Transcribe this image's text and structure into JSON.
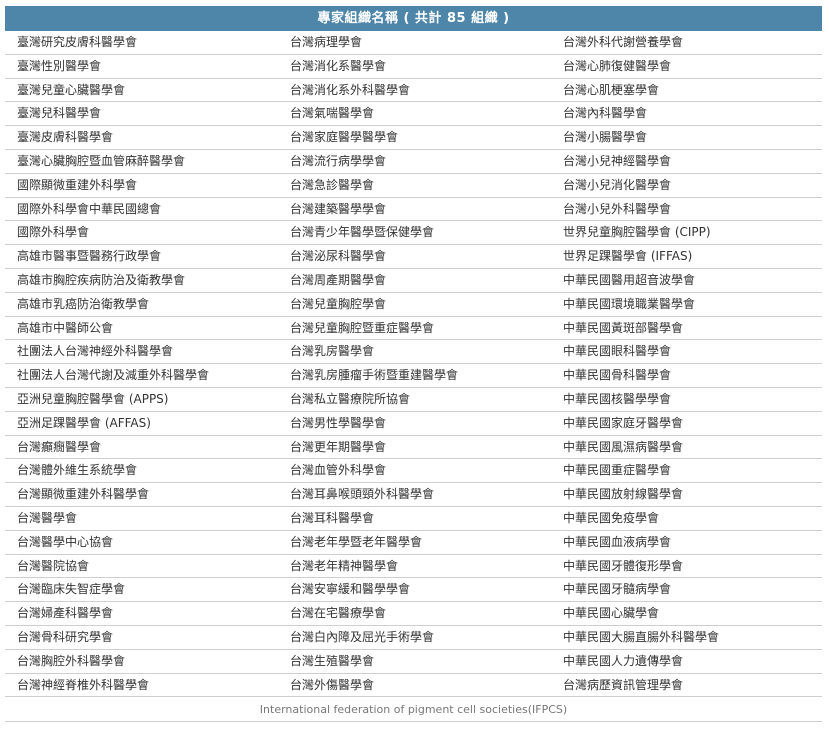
{
  "table": {
    "title": "專家組織名稱 ( 共計 85 組織 )",
    "columns": [
      [
        "臺灣研究皮膚科醫學會",
        "臺灣性別醫學會",
        "臺灣兒童心臟醫學會",
        "臺灣兒科醫學會",
        "臺灣皮膚科醫學會",
        "臺灣心臟胸腔暨血管麻醉醫學會",
        "國際顯微重建外科學會",
        "國際外科學會中華民國總會",
        "國際外科學會",
        "高雄市醫事暨醫務行政學會",
        "高雄市胸腔疾病防治及衛教學會",
        "高雄市乳癌防治衛教學會",
        "高雄市中醫師公會",
        "社團法人台灣神經外科醫學會",
        "社團法人台灣代謝及減重外科醫學會",
        "亞洲兒童胸腔醫學會 (APPS)",
        "亞洲足踝醫學會 (AFFAS)",
        "台灣癲癇醫學會",
        "台灣體外維生系統學會",
        "台灣顯微重建外科醫學會",
        "台灣醫學會",
        "台灣醫學中心協會",
        "台灣醫院協會",
        "台灣臨床失智症學會",
        "台灣婦產科醫學會",
        "台灣骨科研究學會",
        "台灣胸腔外科醫學會",
        "台灣神經脊椎外科醫學會"
      ],
      [
        "台灣病理學會",
        "台灣消化系醫學會",
        "台灣消化系外科醫學會",
        "台灣氣喘醫學會",
        "台灣家庭醫學醫學會",
        "台灣流行病學學會",
        "台灣急診醫學會",
        "台灣建築醫學學會",
        "台灣青少年醫學暨保健學會",
        "台灣泌尿科醫學會",
        "台灣周產期醫學會",
        "台灣兒童胸腔學會",
        "台灣兒童胸腔暨重症醫學會",
        "台灣乳房醫學會",
        "台灣乳房腫瘤手術暨重建醫學會",
        "台灣私立醫療院所協會",
        "台灣男性學醫學會",
        "台灣更年期醫學會",
        "台灣血管外科學會",
        "台灣耳鼻喉頭頸外科醫學會",
        "台灣耳科醫學會",
        "台灣老年學暨老年醫學會",
        "台灣老年精神醫學會",
        "台灣安寧緩和醫學學會",
        "台灣在宅醫療學會",
        "台灣白內障及屈光手術學會",
        "台灣生殖醫學會",
        "台灣外傷醫學會"
      ],
      [
        "台灣外科代謝營養學會",
        "台灣心肺復健醫學會",
        "台灣心肌梗塞學會",
        "台灣內科醫學會",
        "台灣小腸醫學會",
        "台灣小兒神經醫學會",
        "台灣小兒消化醫學會",
        "台灣小兒外科醫學會",
        "世界兒童胸腔醫學會 (CIPP)",
        "世界足踝醫學會 (IFFAS)",
        "中華民國醫用超音波學會",
        "中華民國環境職業醫學會",
        "中華民國黃斑部醫學會",
        "中華民國眼科醫學會",
        "中華民國骨科醫學會",
        "中華民國核醫學學會",
        "中華民國家庭牙醫學會",
        "中華民國風濕病醫學會",
        "中華民國重症醫學會",
        "中華民國放射線醫學會",
        "中華民國免疫學會",
        "中華民國血液病學會",
        "中華民國牙體復形學會",
        "中華民國牙髓病學會",
        "中華民國心臟學會",
        "中華民國大腸直腸外科醫學會",
        "中華民國人力遺傳學會",
        "台灣病歷資訊管理學會"
      ]
    ],
    "footer": "International federation of pigment cell societies(IFPCS)"
  },
  "colors": {
    "header_bg": "#4d86a9",
    "header_text": "#ffffff",
    "row_border": "#cfcfcf",
    "text": "#333333",
    "footer_text": "#777777"
  }
}
